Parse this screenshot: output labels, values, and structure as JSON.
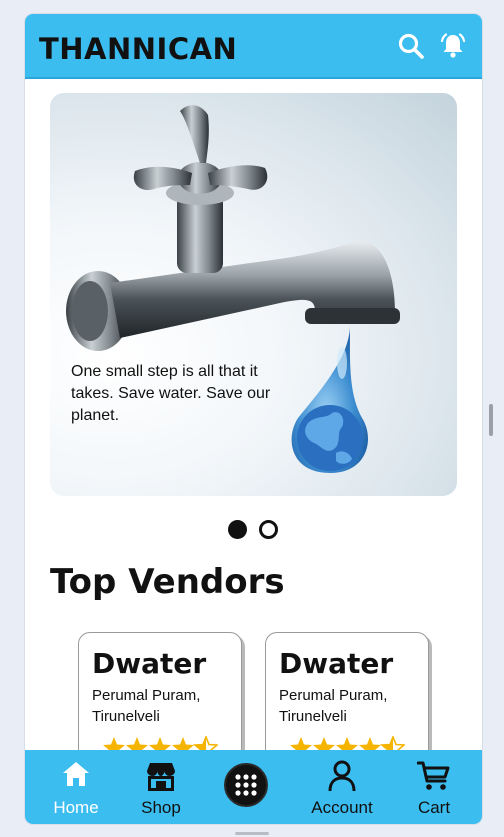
{
  "app": {
    "brand": "THANNICAN"
  },
  "header": {
    "icons": [
      "search-icon",
      "bell-icon"
    ]
  },
  "banner": {
    "caption": "One small step is all that it takes. Save water. Save our planet.",
    "slides_total": 2,
    "active_slide": 1
  },
  "section": {
    "title": "Top Vendors"
  },
  "vendors": [
    {
      "name": "Dwater",
      "address": "Perumal Puram, Tirunelveli",
      "rating": 4.5
    },
    {
      "name": "Dwater",
      "address": "Perumal Puram, Tirunelveli",
      "rating": 4.5
    }
  ],
  "bottom_nav": {
    "items": [
      {
        "label": "Home",
        "icon": "home-icon",
        "active": true
      },
      {
        "label": "Shop",
        "icon": "shop-icon",
        "active": false
      },
      {
        "label": "",
        "icon": "grid-menu-icon",
        "active": false
      },
      {
        "label": "Account",
        "icon": "account-icon",
        "active": false
      },
      {
        "label": "Cart",
        "icon": "cart-icon",
        "active": false
      }
    ]
  },
  "colors": {
    "accent": "#3bbdf0",
    "text": "#111111",
    "star": "#f4b400"
  }
}
